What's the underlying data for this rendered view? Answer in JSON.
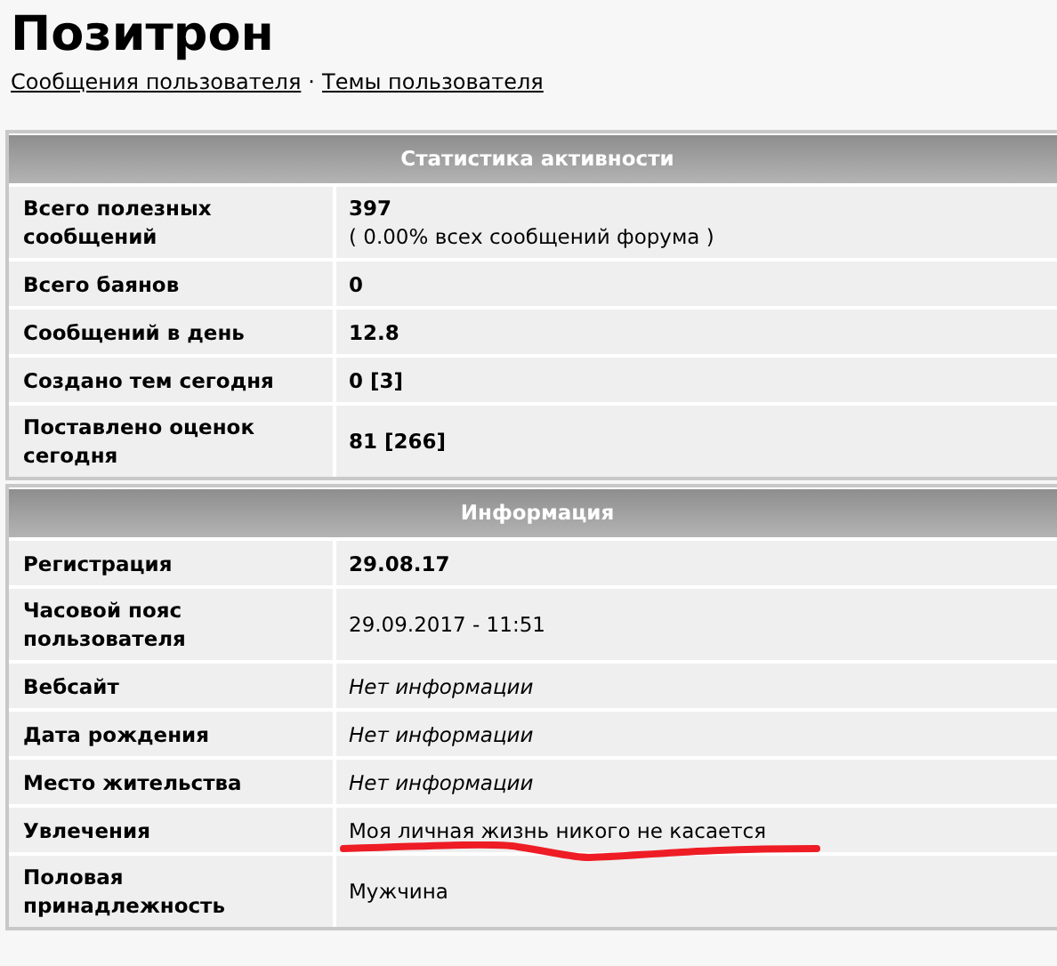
{
  "title": "Позитрон",
  "links": [
    "Сообщения пользователя",
    "Темы пользователя"
  ],
  "link_separator": "·",
  "sections": [
    {
      "heading": "Статистика активности",
      "rows": [
        {
          "label": "Всего полезных сообщений",
          "value": "397",
          "note": "( 0.00% всех сообщений форума )",
          "kind": "bold",
          "underlined": false
        },
        {
          "label": "Всего баянов",
          "value": "0",
          "kind": "bold",
          "underlined": false
        },
        {
          "label": "Сообщений в день",
          "value": "12.8",
          "kind": "bold",
          "underlined": false
        },
        {
          "label": "Создано тем сегодня",
          "value": "0 [3]",
          "kind": "bold",
          "underlined": false
        },
        {
          "label": "Поставлено оценок сегодня",
          "value": "81 [266]",
          "kind": "bold",
          "underlined": false
        }
      ]
    },
    {
      "heading": "Информация",
      "rows": [
        {
          "label": "Регистрация",
          "value": "29.08.17",
          "kind": "bold",
          "underlined": false
        },
        {
          "label": "Часовой пояс пользователя",
          "value": "29.09.2017 - 11:51",
          "kind": "plain",
          "underlined": false
        },
        {
          "label": "Вебсайт",
          "value": "Нет информации",
          "kind": "italic",
          "underlined": false
        },
        {
          "label": "Дата рождения",
          "value": "Нет информации",
          "kind": "italic",
          "underlined": false
        },
        {
          "label": "Место жительства",
          "value": "Нет информации",
          "kind": "italic",
          "underlined": false
        },
        {
          "label": "Увлечения",
          "value": "Моя личная жизнь никого не касается",
          "kind": "plain",
          "underlined": true
        },
        {
          "label": "Половая принадлежность",
          "value": "Мужчина",
          "kind": "plain",
          "underlined": false
        }
      ]
    }
  ]
}
